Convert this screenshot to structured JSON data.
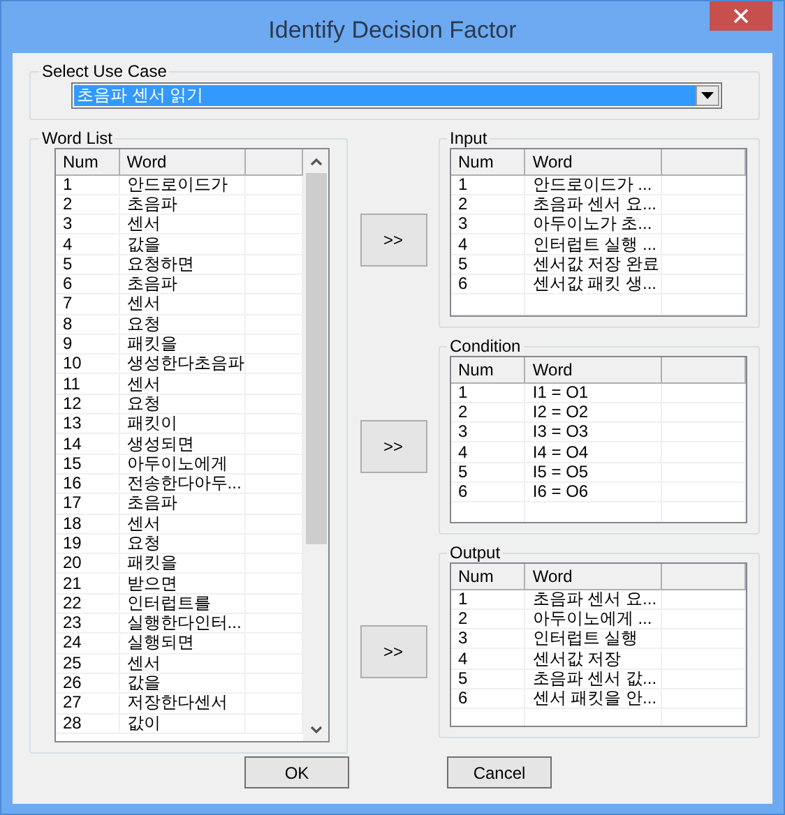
{
  "window": {
    "title": "Identify Decision Factor"
  },
  "use_case": {
    "label": "Select Use Case",
    "value": "초음파 센서 읽기"
  },
  "word_list": {
    "label": "Word List",
    "columns": [
      "Num",
      "Word"
    ],
    "rows": [
      {
        "num": "1",
        "word": "안드로이드가"
      },
      {
        "num": "2",
        "word": "초음파"
      },
      {
        "num": "3",
        "word": "센서"
      },
      {
        "num": "4",
        "word": "값을"
      },
      {
        "num": "5",
        "word": "요청하면"
      },
      {
        "num": "6",
        "word": "초음파"
      },
      {
        "num": "7",
        "word": "센서"
      },
      {
        "num": "8",
        "word": "요청"
      },
      {
        "num": "9",
        "word": "패킷을"
      },
      {
        "num": "10",
        "word": "생성한다초음파"
      },
      {
        "num": "11",
        "word": "센서"
      },
      {
        "num": "12",
        "word": "요청"
      },
      {
        "num": "13",
        "word": "패킷이"
      },
      {
        "num": "14",
        "word": "생성되면"
      },
      {
        "num": "15",
        "word": "아두이노에게"
      },
      {
        "num": "16",
        "word": "전송한다아두..."
      },
      {
        "num": "17",
        "word": "초음파"
      },
      {
        "num": "18",
        "word": "센서"
      },
      {
        "num": "19",
        "word": "요청"
      },
      {
        "num": "20",
        "word": "패킷을"
      },
      {
        "num": "21",
        "word": "받으면"
      },
      {
        "num": "22",
        "word": "인터럽트를"
      },
      {
        "num": "23",
        "word": "실행한다인터..."
      },
      {
        "num": "24",
        "word": "실행되면"
      },
      {
        "num": "25",
        "word": "센서"
      },
      {
        "num": "26",
        "word": "값을"
      },
      {
        "num": "27",
        "word": "저장한다센서"
      },
      {
        "num": "28",
        "word": "값이"
      }
    ]
  },
  "panels": [
    {
      "label": "Input",
      "move_button": ">>",
      "columns": [
        "Num",
        "Word"
      ],
      "rows": [
        {
          "num": "1",
          "word": "안드로이드가 ..."
        },
        {
          "num": "2",
          "word": "초음파 센서 요..."
        },
        {
          "num": "3",
          "word": "아두이노가 초..."
        },
        {
          "num": "4",
          "word": "인터럽트 실행 ..."
        },
        {
          "num": "5",
          "word": "센서값 저장 완료"
        },
        {
          "num": "6",
          "word": "센서값 패킷 생..."
        }
      ]
    },
    {
      "label": "Condition",
      "move_button": ">>",
      "columns": [
        "Num",
        "Word"
      ],
      "rows": [
        {
          "num": "1",
          "word": "I1 = O1"
        },
        {
          "num": "2",
          "word": "I2 = O2"
        },
        {
          "num": "3",
          "word": "I3 = O3"
        },
        {
          "num": "4",
          "word": "I4 = O4"
        },
        {
          "num": "5",
          "word": "I5 = O5"
        },
        {
          "num": "6",
          "word": "I6 = O6"
        }
      ]
    },
    {
      "label": "Output",
      "move_button": ">>",
      "columns": [
        "Num",
        "Word"
      ],
      "rows": [
        {
          "num": "1",
          "word": "초음파 센서 요..."
        },
        {
          "num": "2",
          "word": "아두이노에게 ..."
        },
        {
          "num": "3",
          "word": "인터럽트 실행"
        },
        {
          "num": "4",
          "word": "센서값 저장"
        },
        {
          "num": "5",
          "word": "초음파 센서 값..."
        },
        {
          "num": "6",
          "word": "센서 패킷을 안..."
        }
      ]
    }
  ],
  "buttons": [
    "OK",
    "Cancel"
  ]
}
